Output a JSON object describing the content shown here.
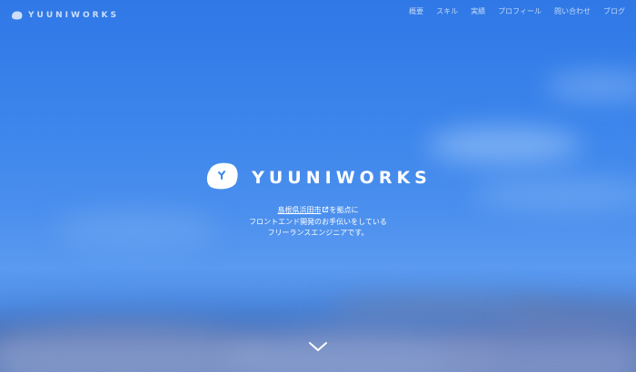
{
  "header": {
    "brand": "YUUNIWORKS",
    "brand_icon": "stone-logo-icon",
    "nav": [
      "概要",
      "スキル",
      "実績",
      "プロフィール",
      "問い合わせ",
      "ブログ"
    ]
  },
  "hero": {
    "logo_text": "YUUNIWORKS",
    "logo_icon": "stone-logo-icon",
    "tagline_link": "島根県浜田市",
    "tagline_line1_rest": "を拠点に",
    "tagline_line2": "フロントエンド開発のお手伝いをしている",
    "tagline_line3": "フリーランスエンジニアです。",
    "external_link_icon": "external-link-icon",
    "scroll_icon": "chevron-down-icon"
  },
  "colors": {
    "background": "#3d86ec",
    "text": "#ffffff"
  }
}
